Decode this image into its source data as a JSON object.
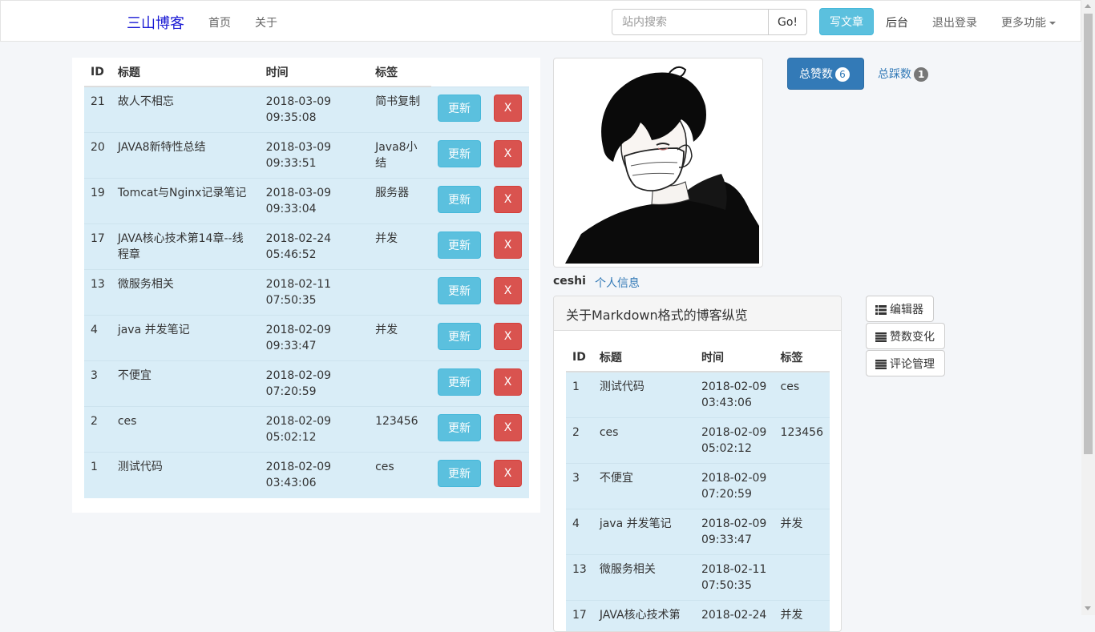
{
  "navbar": {
    "brand": "三山博客",
    "links": [
      "首页",
      "关于"
    ],
    "search_placeholder": "站内搜索",
    "search_button": "Go!",
    "write_button": "写文章",
    "admin_link": "后台",
    "logout_link": "退出登录",
    "more_menu": "更多功能"
  },
  "articles_table": {
    "headers": [
      "ID",
      "标题",
      "时间",
      "标签"
    ],
    "update_label": "更新",
    "delete_label": "X",
    "rows": [
      {
        "id": "21",
        "title": "故人不相忘",
        "date": "2018-03-09",
        "time": "09:35:08",
        "tag": "简书复制"
      },
      {
        "id": "20",
        "title": "JAVA8新特性总结",
        "date": "2018-03-09",
        "time": "09:33:51",
        "tag": "Java8小结"
      },
      {
        "id": "19",
        "title": "Tomcat与Nginx记录笔记",
        "date": "2018-03-09",
        "time": "09:33:04",
        "tag": "服务器"
      },
      {
        "id": "17",
        "title": "JAVA核心技术第14章--线程章",
        "date": "2018-02-24",
        "time": "05:46:52",
        "tag": "并发"
      },
      {
        "id": "13",
        "title": "微服务相关",
        "date": "2018-02-11",
        "time": "07:50:35",
        "tag": ""
      },
      {
        "id": "4",
        "title": "java 并发笔记",
        "date": "2018-02-09",
        "time": "09:33:47",
        "tag": "并发"
      },
      {
        "id": "3",
        "title": "不便宜",
        "date": "2018-02-09",
        "time": "07:20:59",
        "tag": ""
      },
      {
        "id": "2",
        "title": "ces",
        "date": "2018-02-09",
        "time": "05:02:12",
        "tag": "123456"
      },
      {
        "id": "1",
        "title": "测试代码",
        "date": "2018-02-09",
        "time": "03:43:06",
        "tag": "ces"
      }
    ]
  },
  "profile": {
    "username": "ceshi",
    "profile_link": "个人信息",
    "likes_label": "总赞数",
    "likes_count": "6",
    "dislikes_label": "总踩数",
    "dislikes_count": "1"
  },
  "markdown_panel": {
    "heading": "关于Markdown格式的博客纵览",
    "headers": [
      "ID",
      "标题",
      "时间",
      "标签"
    ],
    "rows": [
      {
        "id": "1",
        "title": "测试代码",
        "date": "2018-02-09",
        "time": "03:43:06",
        "tag": "ces"
      },
      {
        "id": "2",
        "title": "ces",
        "date": "2018-02-09",
        "time": "05:02:12",
        "tag": "123456"
      },
      {
        "id": "3",
        "title": "不便宜",
        "date": "2018-02-09",
        "time": "07:20:59",
        "tag": ""
      },
      {
        "id": "4",
        "title": "java 并发笔记",
        "date": "2018-02-09",
        "time": "09:33:47",
        "tag": "并发"
      },
      {
        "id": "13",
        "title": "微服务相关",
        "date": "2018-02-11",
        "time": "07:50:35",
        "tag": ""
      },
      {
        "id": "17",
        "title": "JAVA核心技术第",
        "date": "2018-02-24",
        "time": "",
        "tag": "并发"
      }
    ]
  },
  "tools": {
    "editor": "编辑器",
    "likes_change": "赞数变化",
    "comments": "评论管理"
  },
  "icons": {
    "list": "list-icon",
    "caret": "caret-down-icon"
  }
}
